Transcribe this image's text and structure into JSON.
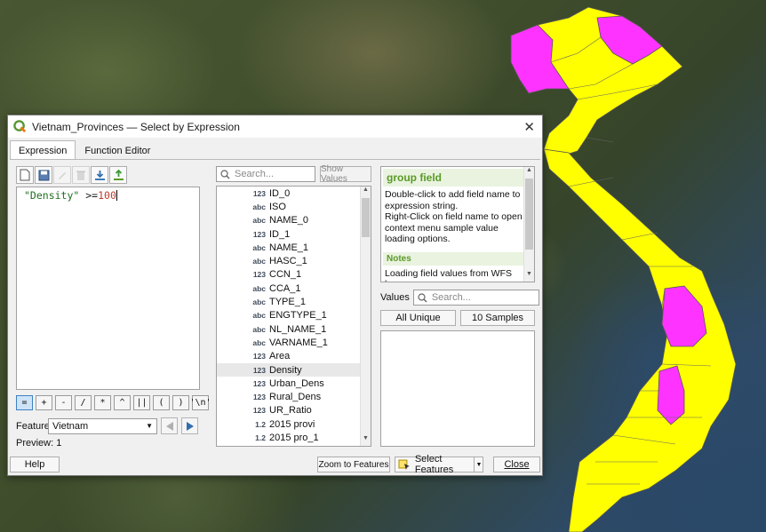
{
  "dialog": {
    "title": "Vietnam_Provinces — Select by Expression",
    "tabs": [
      "Expression",
      "Function Editor"
    ]
  },
  "expression": {
    "field": "\"Density\"",
    "operator": " >=",
    "value": "100"
  },
  "operators": [
    "=",
    "+",
    "-",
    "/",
    "*",
    "^",
    "||",
    "(",
    ")",
    "'\\n'"
  ],
  "feature": {
    "label": "Feature",
    "value": "Vietnam"
  },
  "preview": {
    "label": "Preview:",
    "value": "1"
  },
  "field_search": {
    "placeholder": "Search...",
    "show_values": "Show Values"
  },
  "fields": [
    {
      "type": "123",
      "name": "ID_0"
    },
    {
      "type": "abc",
      "name": "ISO"
    },
    {
      "type": "abc",
      "name": "NAME_0"
    },
    {
      "type": "123",
      "name": "ID_1"
    },
    {
      "type": "abc",
      "name": "NAME_1"
    },
    {
      "type": "abc",
      "name": "HASC_1"
    },
    {
      "type": "123",
      "name": "CCN_1"
    },
    {
      "type": "abc",
      "name": "CCA_1"
    },
    {
      "type": "abc",
      "name": "TYPE_1"
    },
    {
      "type": "abc",
      "name": "ENGTYPE_1"
    },
    {
      "type": "abc",
      "name": "NL_NAME_1"
    },
    {
      "type": "abc",
      "name": "VARNAME_1"
    },
    {
      "type": "123",
      "name": "Area"
    },
    {
      "type": "123",
      "name": "Density"
    },
    {
      "type": "123",
      "name": "Urban_Dens"
    },
    {
      "type": "123",
      "name": "Rural_Dens"
    },
    {
      "type": "123",
      "name": "UR_Ratio"
    },
    {
      "type": "1.2",
      "name": "2015 provi"
    },
    {
      "type": "1.2",
      "name": "2015 pro_1"
    }
  ],
  "selected_field": "Density",
  "help": {
    "title": "group field",
    "line1": "Double-click to add field name to expression string.",
    "line2": "Right-Click on field name to open context menu sample value loading options.",
    "notes_title": "Notes",
    "notes_text": "Loading field values from WFS layers"
  },
  "values": {
    "label": "Values",
    "placeholder": "Search...",
    "all_unique": "All Unique",
    "samples": "10 Samples"
  },
  "buttons": {
    "help": "Help",
    "zoom": "Zoom to Features",
    "select": "Select Features",
    "close": "Close"
  },
  "colors": {
    "selected_province": "#ff33ff",
    "other_province": "#ffff00",
    "accent_green": "#5a9a25"
  },
  "icons": {
    "qgis": "qgis-logo-icon",
    "new": "new-file-icon",
    "save": "save-icon",
    "edit": "edit-icon",
    "delete": "delete-icon",
    "import": "import-icon",
    "export": "export-icon"
  }
}
